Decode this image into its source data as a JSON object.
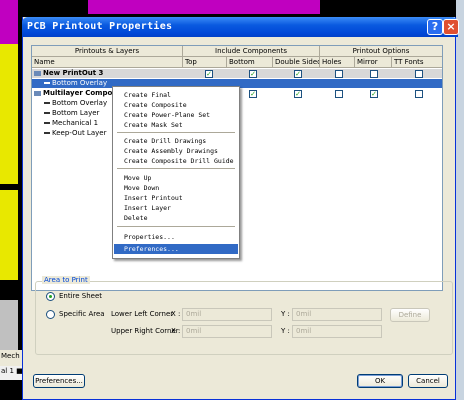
{
  "background": {
    "tab_mech": "Mech",
    "tab_layer": "al 1 ■"
  },
  "dialog": {
    "title": "PCB Printout Properties",
    "help_btn": "?",
    "close_btn": "×"
  },
  "grid": {
    "group_headers": {
      "printouts": "Printouts & Layers",
      "include": "Include Components",
      "options": "Printout Options"
    },
    "columns": [
      "Name",
      "Top",
      "Bottom",
      "Double Sided",
      "Holes",
      "Mirror",
      "TT Fonts"
    ],
    "rows": [
      {
        "label": "New PrintOut 3",
        "checks": [
          true,
          true,
          true,
          false,
          false,
          false
        ]
      },
      {
        "label": "Bottom Overlay",
        "checks": [
          false,
          false,
          false,
          false,
          false,
          false
        ]
      },
      {
        "label": "Multilayer Compos",
        "checks": [
          true,
          true,
          true,
          false,
          true,
          false
        ]
      },
      {
        "label": "Bottom Overlay"
      },
      {
        "label": "Bottom Layer"
      },
      {
        "label": "Mechanical 1"
      },
      {
        "label": "Keep-Out Layer"
      }
    ]
  },
  "context_menu": {
    "items": [
      "Create Final",
      "Create Composite",
      "Create Power-Plane Set",
      "Create Mask Set",
      "Create Drill Drawings",
      "Create Assembly Drawings",
      "Create Composite Drill Guide",
      "Move Up",
      "Move Down",
      "Insert Printout",
      "Insert Layer",
      "Delete",
      "Properties...",
      "Preferences..."
    ],
    "active_index": 13
  },
  "area_to_print": {
    "legend": "Area to Print",
    "entire_sheet": "Entire Sheet",
    "specific_area": "Specific Area",
    "selected": "entire_sheet",
    "lower_left": "Lower Left Corner",
    "upper_right": "Upper Right Corner",
    "x_label": "X :",
    "y_label": "Y :",
    "ll_x": "0mil",
    "ll_y": "0mil",
    "ur_x": "0mil",
    "ur_y": "0mil",
    "define": "Define"
  },
  "footer": {
    "preferences": "Preferences...",
    "ok": "OK",
    "cancel": "Cancel"
  },
  "colors": {
    "selection": "#316ac5",
    "titlebar": "#0048d8",
    "dialog_bg": "#ece9d8"
  }
}
